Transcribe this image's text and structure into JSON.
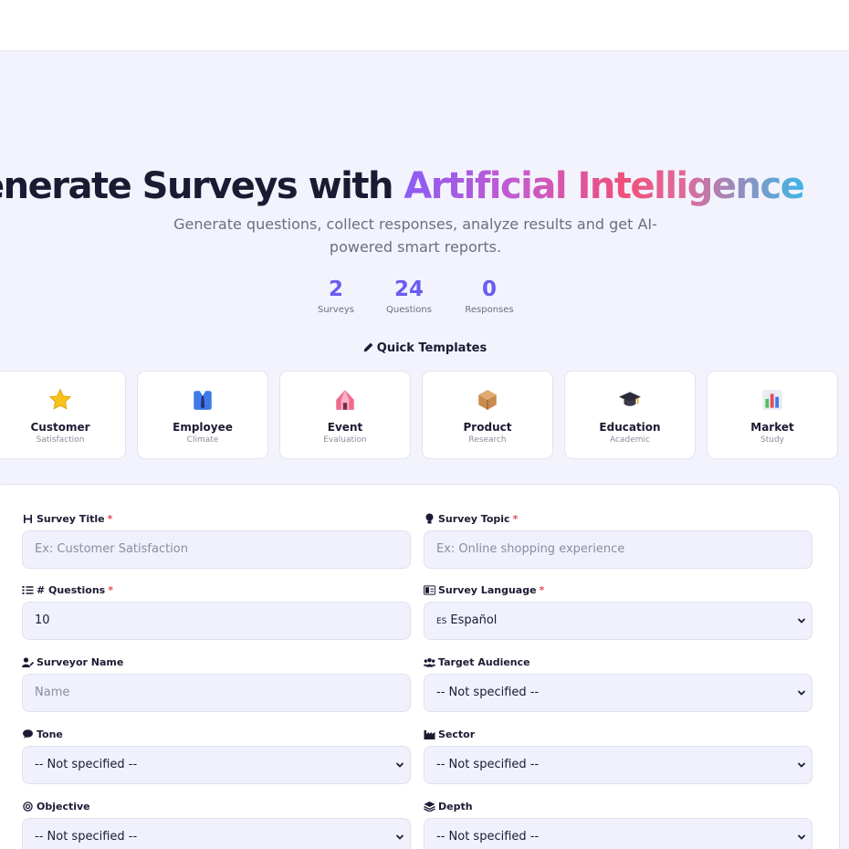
{
  "hero": {
    "title_main": "enerate Surveys with ",
    "title_accent": "Artificial Intelligence",
    "subtitle": "Generate questions, collect responses, analyze results and get AI-powered smart reports."
  },
  "stats": [
    {
      "value": "2",
      "label": "Surveys"
    },
    {
      "value": "24",
      "label": "Questions"
    },
    {
      "value": "0",
      "label": "Responses"
    }
  ],
  "templates_title": "Quick Templates",
  "templates": [
    {
      "title": "Customer",
      "subtitle": "Satisfaction",
      "icon": "star-icon"
    },
    {
      "title": "Employee",
      "subtitle": "Climate",
      "icon": "employee-icon"
    },
    {
      "title": "Event",
      "subtitle": "Evaluation",
      "icon": "circus-tent-icon"
    },
    {
      "title": "Product",
      "subtitle": "Research",
      "icon": "package-icon"
    },
    {
      "title": "Education",
      "subtitle": "Academic",
      "icon": "graduation-cap-icon"
    },
    {
      "title": "Market",
      "subtitle": "Study",
      "icon": "bar-chart-icon"
    }
  ],
  "form": {
    "survey_title": {
      "label": "Survey Title",
      "placeholder": "Ex: Customer Satisfaction"
    },
    "survey_topic": {
      "label": "Survey Topic",
      "placeholder": "Ex: Online shopping experience"
    },
    "questions": {
      "label": "# Questions",
      "value": "10"
    },
    "language": {
      "label": "Survey Language",
      "badge": "ES",
      "value": "Español"
    },
    "surveyor": {
      "label": "Surveyor Name",
      "placeholder": "Name"
    },
    "audience": {
      "label": "Target Audience",
      "value": "-- Not specified --"
    },
    "tone": {
      "label": "Tone",
      "value": "-- Not specified --"
    },
    "sector": {
      "label": "Sector",
      "value": "-- Not specified --"
    },
    "objective": {
      "label": "Objective",
      "value": "-- Not specified --"
    },
    "depth": {
      "label": "Depth",
      "value": "-- Not specified --"
    },
    "required_mark": "*"
  },
  "colors": {
    "accent": "#6a5cf0",
    "required": "#e24b5c",
    "field_bg": "#f0f1fd"
  }
}
